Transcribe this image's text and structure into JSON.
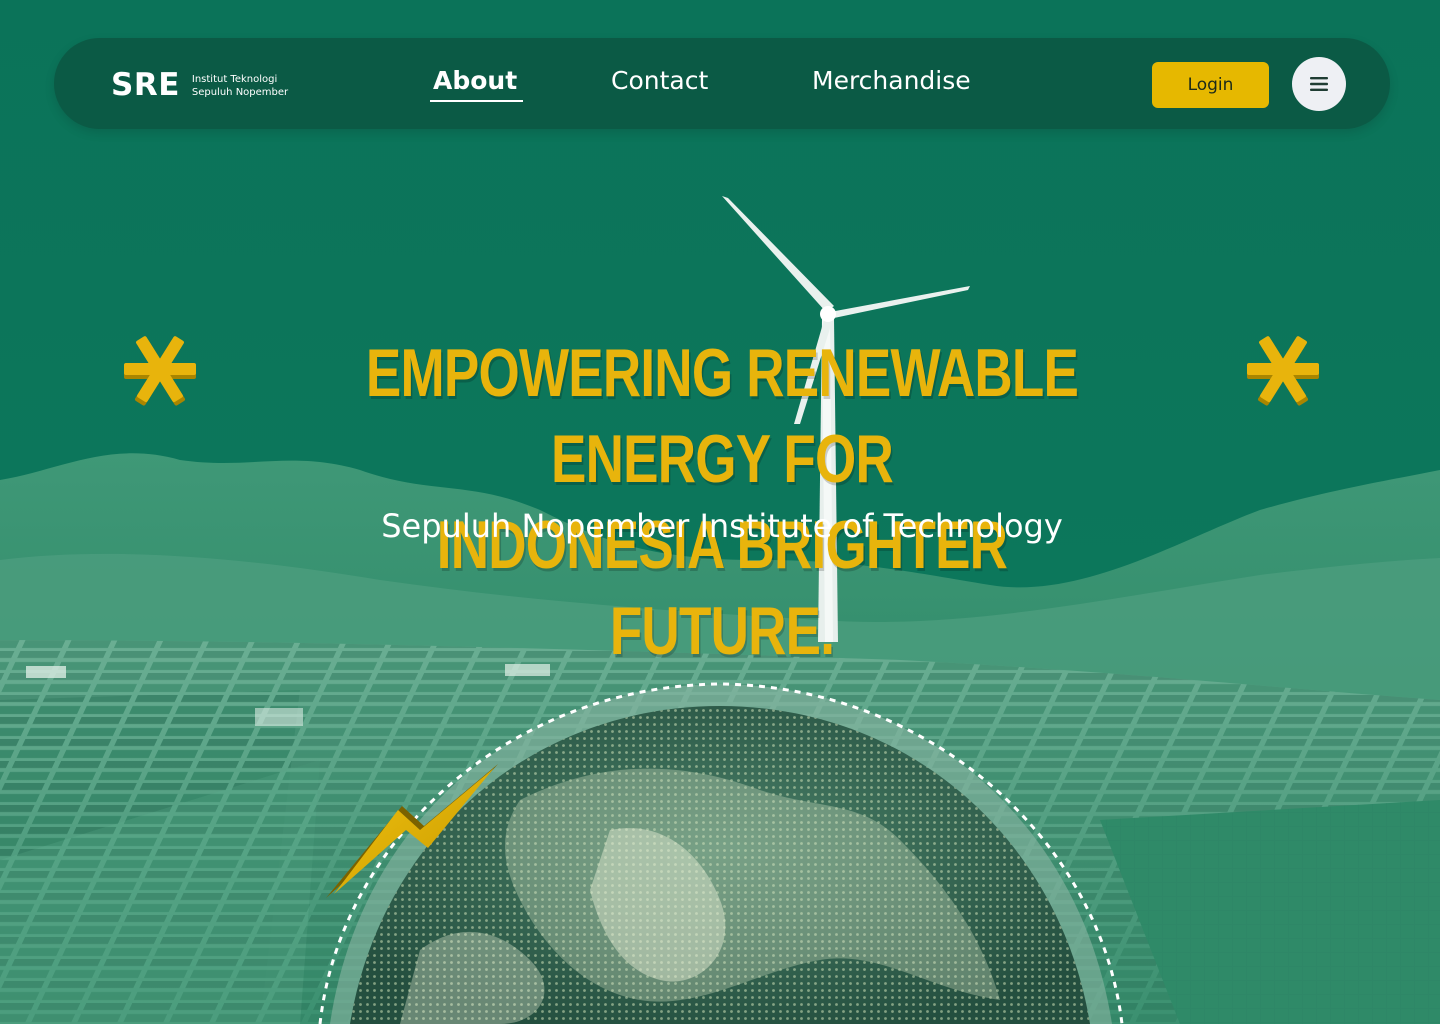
{
  "brand": {
    "logo_text": "SRE",
    "subtitle_line1": "Institut Teknologi",
    "subtitle_line2": "Sepuluh Nopember"
  },
  "nav": {
    "items": [
      {
        "label": "About",
        "active": true
      },
      {
        "label": "Contact"
      },
      {
        "label": "Merchandise"
      }
    ],
    "login_label": "Login",
    "menu_icon": "hamburger-icon"
  },
  "hero": {
    "headline_line1": "EMPOWERING RENEWABLE ENERGY FOR",
    "headline_line2": "INDONESIA BRIGHTER FUTURE.",
    "subheadline": "Sepuluh Nopember Institute of Technology"
  },
  "colors": {
    "background": "#0b7359",
    "navbar": "#0b5a45",
    "accent_yellow": "#e6b800",
    "headline_yellow": "#e8b40c",
    "menu_button": "#eef0f4"
  },
  "decorations": {
    "star_icon": "asterisk-star-icon",
    "lightning_icon": "lightning-bolt-icon",
    "globe_icon": "earth-globe-image",
    "turbine": "wind-turbine-image",
    "landscape": "solar-field-hills-image"
  }
}
